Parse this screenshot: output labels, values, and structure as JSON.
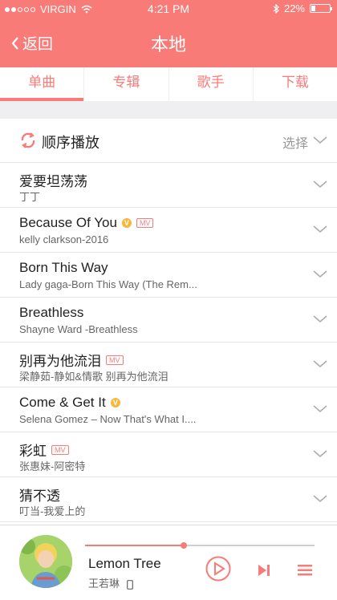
{
  "status": {
    "carrier": "VIRGIN",
    "time": "4:21 PM",
    "battery": "22%",
    "battery_level": 0.22
  },
  "nav": {
    "back_label": "返回",
    "title": "本地"
  },
  "tabs": [
    {
      "label": "单曲"
    },
    {
      "label": "专辑"
    },
    {
      "label": "歌手"
    },
    {
      "label": "下载"
    }
  ],
  "playmode": {
    "label": "顺序播放",
    "select_label": "选择"
  },
  "songs": [
    {
      "title": "爱要坦荡荡",
      "subtitle": "丁丁"
    },
    {
      "title": "Because Of You",
      "subtitle": "kelly clarkson-2016",
      "v_badge": "V",
      "mv_badge": "MV"
    },
    {
      "title": "Born This Way",
      "subtitle": "Lady gaga-Born This Way (The Rem..."
    },
    {
      "title": "Breathless",
      "subtitle": "Shayne Ward -Breathless"
    },
    {
      "title": "别再为他流泪",
      "subtitle": "梁静茹-静如&情歌 别再为他流泪",
      "mv_badge": "MV"
    },
    {
      "title": "Come & Get It",
      "subtitle": "Selena Gomez – Now That's What I....",
      "v_badge": "V"
    },
    {
      "title": "彩虹",
      "subtitle": "张惠妹-阿密特",
      "mv_badge": "MV"
    },
    {
      "title": "猜不透",
      "subtitle": "叮当-我爱上的"
    }
  ],
  "player": {
    "title": "Lemon Tree",
    "artist": "王若琳",
    "progress": 0.43
  },
  "colors": {
    "accent": "#f97b78",
    "background": "#efeff1"
  }
}
